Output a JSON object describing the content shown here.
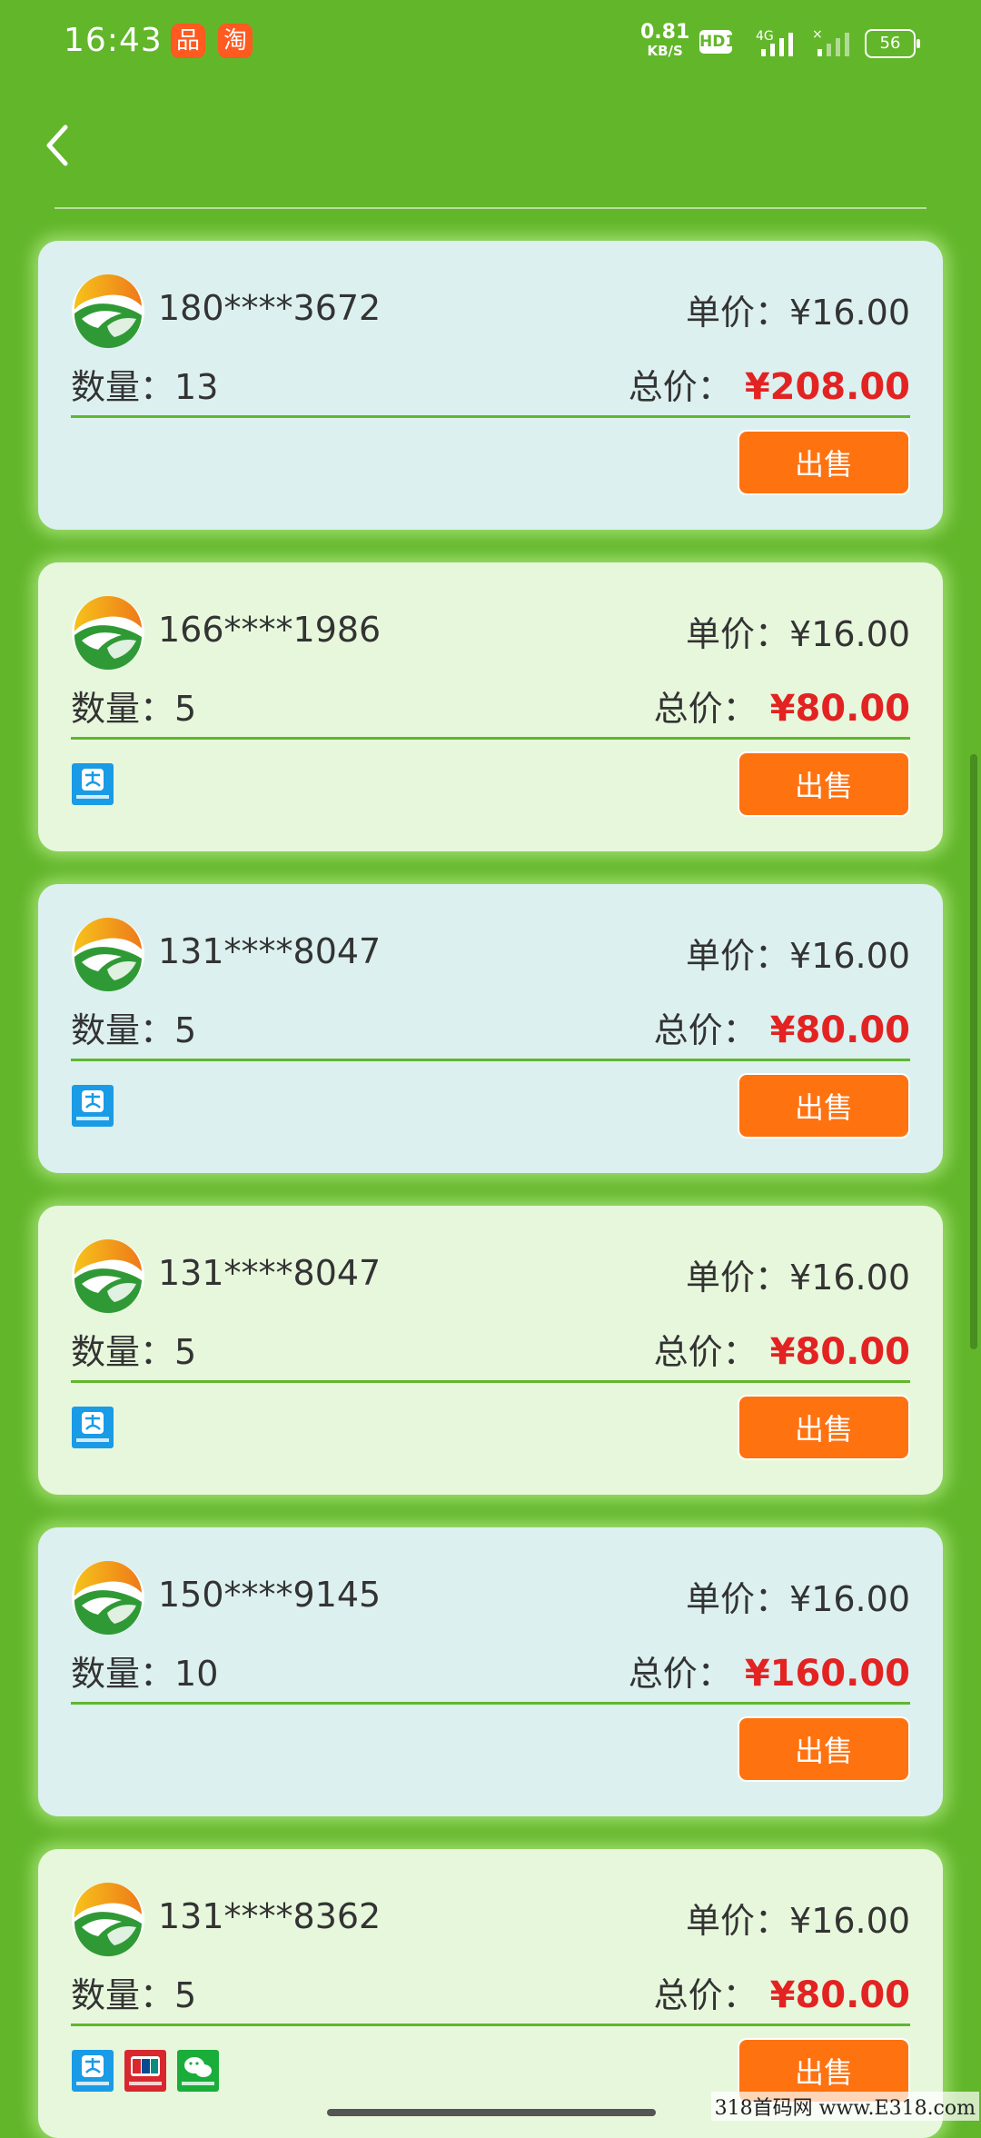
{
  "status_bar": {
    "time": "16:43",
    "apps": [
      "品",
      "淘"
    ],
    "net_speed": "0.81",
    "net_unit": "KB/S",
    "hd": "HD1",
    "network": "4G",
    "battery": "56"
  },
  "colors": {
    "background": "#62b62a",
    "sell_button": "#ff7210",
    "total_amount": "#e32222",
    "divider": "#5fb72d"
  },
  "labels": {
    "unit_price": "单价：",
    "quantity": "数量：",
    "total": "总价：",
    "sell": "出售"
  },
  "orders": [
    {
      "phone": "180****3672",
      "unit_price": "¥16.00",
      "quantity": "13",
      "total": "¥208.00",
      "payments": []
    },
    {
      "phone": "166****1986",
      "unit_price": "¥16.00",
      "quantity": "5",
      "total": "¥80.00",
      "payments": [
        "alipay-icon"
      ]
    },
    {
      "phone": "131****8047",
      "unit_price": "¥16.00",
      "quantity": "5",
      "total": "¥80.00",
      "payments": [
        "alipay-icon"
      ]
    },
    {
      "phone": "131****8047",
      "unit_price": "¥16.00",
      "quantity": "5",
      "total": "¥80.00",
      "payments": [
        "alipay-icon"
      ]
    },
    {
      "phone": "150****9145",
      "unit_price": "¥16.00",
      "quantity": "10",
      "total": "¥160.00",
      "payments": []
    },
    {
      "phone": "131****8362",
      "unit_price": "¥16.00",
      "quantity": "5",
      "total": "¥80.00",
      "payments": [
        "alipay-icon",
        "unionpay-icon",
        "wechat-pay-icon"
      ]
    }
  ],
  "watermark": "318首码网 www.E318.com"
}
